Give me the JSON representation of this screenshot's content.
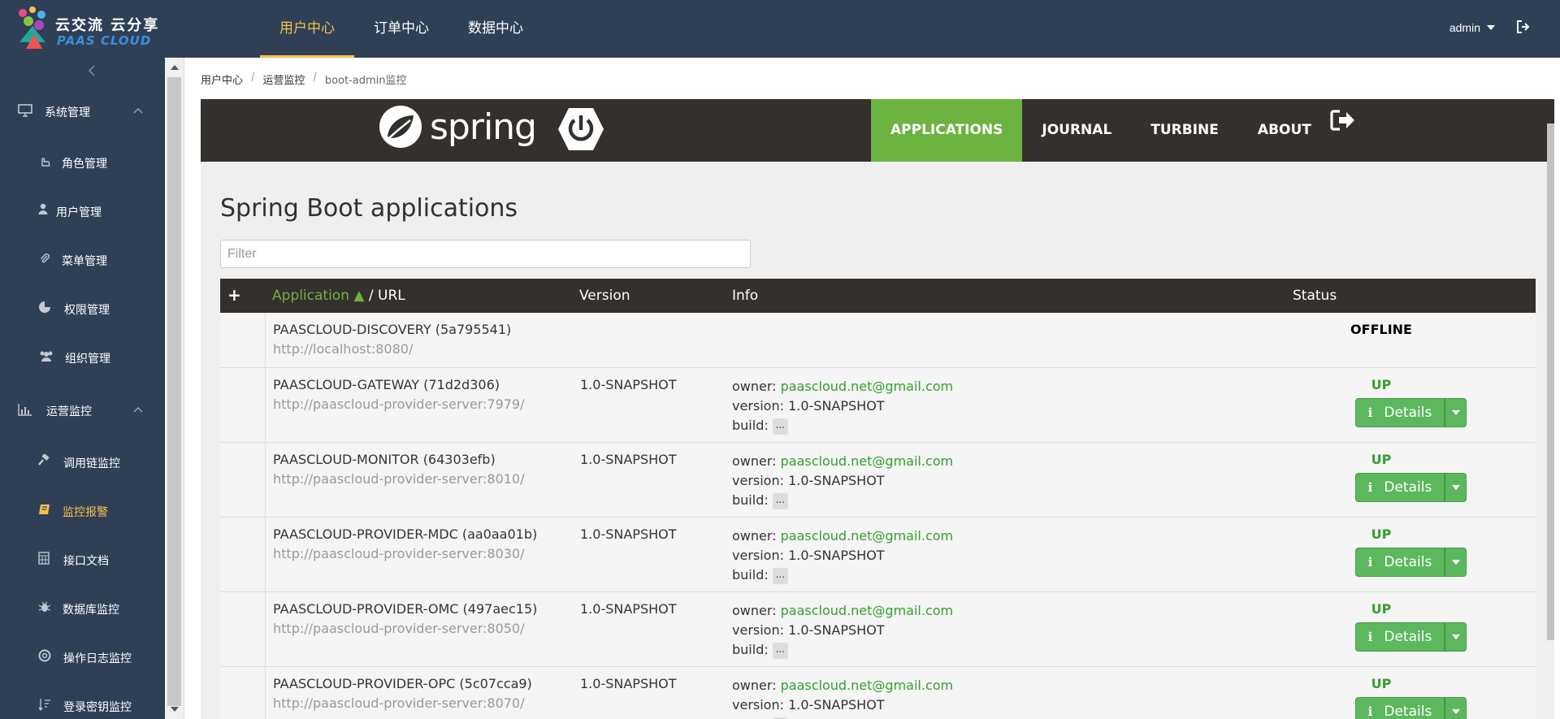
{
  "header": {
    "logo_text_cn": "云交流 云分享",
    "logo_text_en": "PAAS CLOUD",
    "nav": [
      {
        "label": "用户中心",
        "active": true
      },
      {
        "label": "订单中心",
        "active": false
      },
      {
        "label": "数据中心",
        "active": false
      }
    ],
    "user": "admin"
  },
  "sidebar": {
    "groups": [
      {
        "label": "系统管理",
        "items": [
          {
            "label": "角色管理",
            "icon": "hand-pointer-icon"
          },
          {
            "label": "用户管理",
            "icon": "user-icon"
          },
          {
            "label": "菜单管理",
            "icon": "paperclip-icon"
          },
          {
            "label": "权限管理",
            "icon": "pie-icon"
          },
          {
            "label": "组织管理",
            "icon": "users-icon"
          }
        ]
      },
      {
        "label": "运营监控",
        "items": [
          {
            "label": "调用链监控",
            "icon": "gavel-icon"
          },
          {
            "label": "监控报警",
            "icon": "book-icon",
            "active": true
          },
          {
            "label": "接口文档",
            "icon": "calculator-icon"
          },
          {
            "label": "数据库监控",
            "icon": "bug-icon"
          },
          {
            "label": "操作日志监控",
            "icon": "life-ring-icon"
          },
          {
            "label": "登录密钥监控",
            "icon": "sort-icon"
          }
        ]
      }
    ]
  },
  "breadcrumb": [
    "用户中心",
    "运营监控",
    "boot-admin监控"
  ],
  "sba": {
    "logo_word": "spring",
    "menu": [
      {
        "label": "APPLICATIONS",
        "active": true
      },
      {
        "label": "JOURNAL",
        "active": false
      },
      {
        "label": "TURBINE",
        "active": false
      },
      {
        "label": "ABOUT",
        "active": false
      }
    ],
    "title": "Spring Boot applications",
    "filter_placeholder": "Filter",
    "table": {
      "plus": "+",
      "col_app": "Application ▲",
      "col_url": " / URL",
      "col_version": "Version",
      "col_info": "Info",
      "col_status": "Status",
      "info_labels": {
        "owner": "owner: ",
        "version": "version: ",
        "build": "build: "
      },
      "build_btn": "...",
      "details_label": "Details",
      "rows": [
        {
          "name": "PAASCLOUD-DISCOVERY (5a795541)",
          "url": "http://localhost:8080/",
          "version": "",
          "owner": "",
          "info_version": "",
          "status": "OFFLINE"
        },
        {
          "name": "PAASCLOUD-GATEWAY (71d2d306)",
          "url": "http://paascloud-provider-server:7979/",
          "version": "1.0-SNAPSHOT",
          "owner": "paascloud.net@gmail.com",
          "info_version": "1.0-SNAPSHOT",
          "status": "UP"
        },
        {
          "name": "PAASCLOUD-MONITOR (64303efb)",
          "url": "http://paascloud-provider-server:8010/",
          "version": "1.0-SNAPSHOT",
          "owner": "paascloud.net@gmail.com",
          "info_version": "1.0-SNAPSHOT",
          "status": "UP"
        },
        {
          "name": "PAASCLOUD-PROVIDER-MDC (aa0aa01b)",
          "url": "http://paascloud-provider-server:8030/",
          "version": "1.0-SNAPSHOT",
          "owner": "paascloud.net@gmail.com",
          "info_version": "1.0-SNAPSHOT",
          "status": "UP"
        },
        {
          "name": "PAASCLOUD-PROVIDER-OMC (497aec15)",
          "url": "http://paascloud-provider-server:8050/",
          "version": "1.0-SNAPSHOT",
          "owner": "paascloud.net@gmail.com",
          "info_version": "1.0-SNAPSHOT",
          "status": "UP"
        },
        {
          "name": "PAASCLOUD-PROVIDER-OPC (5c07cca9)",
          "url": "http://paascloud-provider-server:8070/",
          "version": "1.0-SNAPSHOT",
          "owner": "paascloud.net@gmail.com",
          "info_version": "1.0-SNAPSHOT",
          "status": "UP"
        }
      ]
    }
  },
  "colors": {
    "header_bg": "#2f4056",
    "active_nav": "#f7c14c",
    "spring_green": "#6db33f",
    "sba_nav_bg": "#34302d",
    "status_up": "#34a02c"
  }
}
